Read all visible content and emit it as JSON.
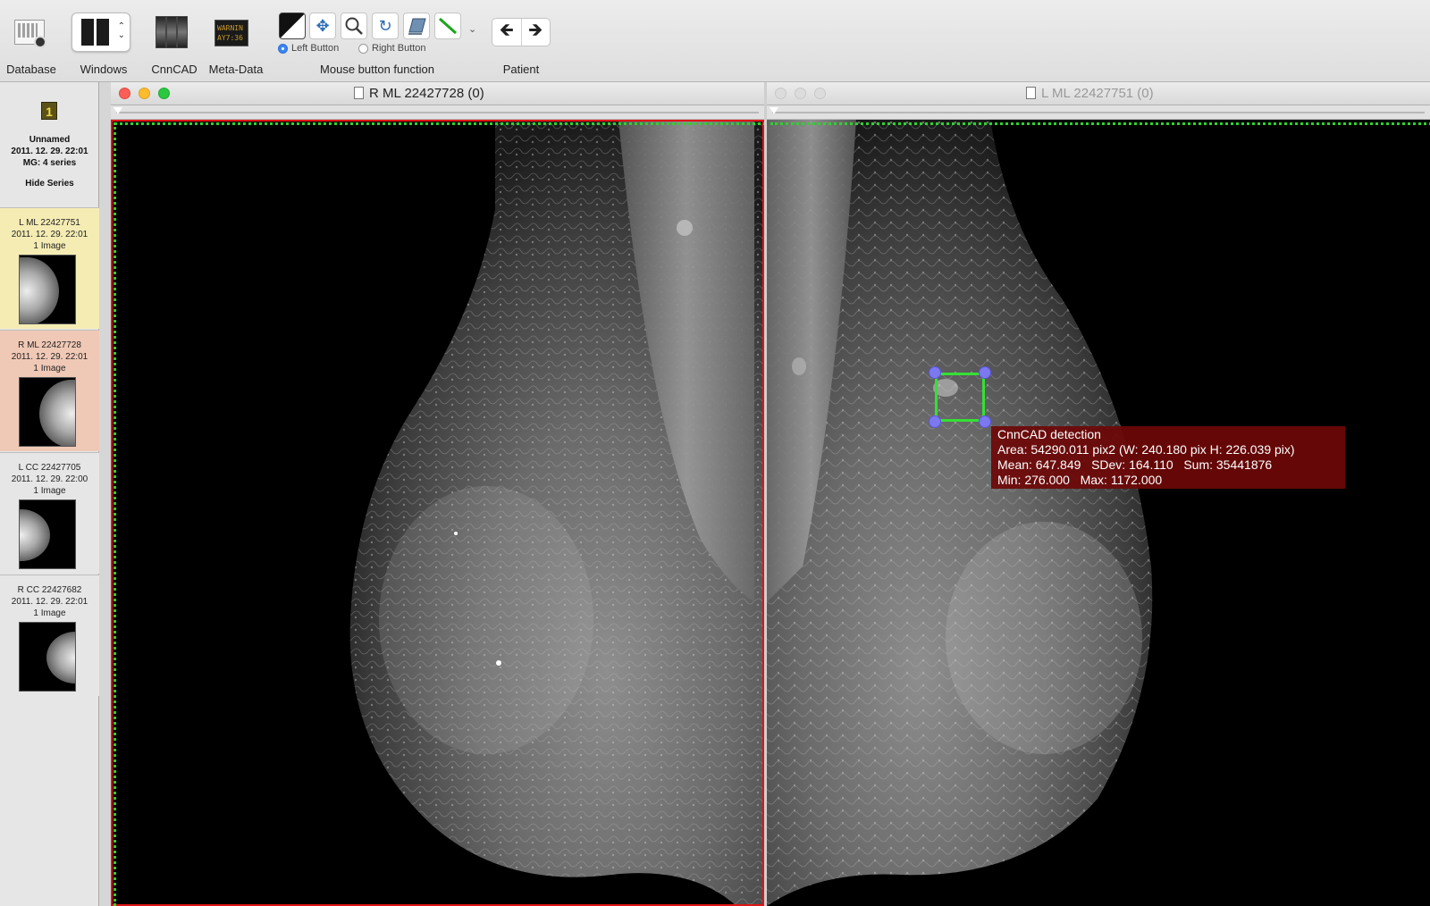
{
  "toolbar": {
    "database_label": "Database",
    "windows_label": "Windows",
    "cnncad_label": "CnnCAD",
    "metadata_label": "Meta-Data",
    "metadata_icon_text": "WARNIN\nAY7:36",
    "mouse_function_label": "Mouse button function",
    "left_button_label": "Left Button",
    "right_button_label": "Right Button",
    "patient_label": "Patient",
    "prev_arrow": "🡸",
    "next_arrow": "🡺"
  },
  "sidebar": {
    "study_number": "1",
    "study_name": "Unnamed",
    "study_date": "2011. 12. 29. 22:01",
    "study_series": "MG: 4 series",
    "hide_series_label": "Hide Series",
    "series": [
      {
        "name": "L ML 22427751",
        "date": "2011. 12. 29. 22:01",
        "count": "1 Image",
        "bg": "#f5ecb4"
      },
      {
        "name": "R ML 22427728",
        "date": "2011. 12. 29. 22:01",
        "count": "1 Image",
        "bg": "#f0c9b6"
      },
      {
        "name": "L CC 22427705",
        "date": "2011. 12. 29. 22:00",
        "count": "1 Image",
        "bg": "#e6e6e6"
      },
      {
        "name": "R CC 22427682",
        "date": "2011. 12. 29. 22:01",
        "count": "1 Image",
        "bg": "#e6e6e6"
      }
    ]
  },
  "viewers": {
    "left_title": "R ML 22427728 (0)",
    "right_title": "L ML 22427751 (0)"
  },
  "roi": {
    "title": "CnnCAD detection",
    "area_line": "Area: 54290.011 pix2 (W: 240.180 pix H: 226.039 pix)",
    "stats_line": "Mean: 647.849   SDev: 164.110   Sum: 35441876",
    "minmax_line": "Min: 276.000   Max: 1172.000"
  },
  "colors": {
    "roi_outline": "#35e035",
    "roi_handle": "#7b78f0",
    "roi_info_bg": "#6e0808",
    "active_frame": "#e01515",
    "sync_frame": "#2bd42b"
  }
}
